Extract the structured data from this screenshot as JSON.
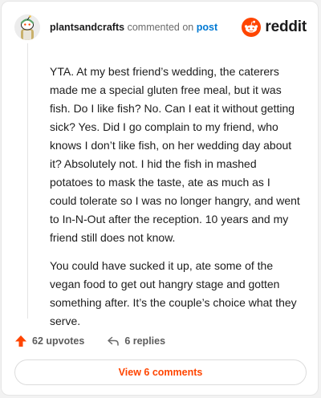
{
  "header": {
    "username": "plantsandcrafts",
    "action_text": "commented on",
    "post_link": "post",
    "brand": "reddit"
  },
  "comment": {
    "paragraphs": [
      "YTA. At my best friend’s wedding, the caterers made me a special gluten free meal, but it was fish. Do I like fish? No. Can I eat it without getting sick? Yes. Did I go complain to my friend, who knows I don’t like fish, on her wedding day about it? Absolutely not. I hid the fish in mashed potatoes to mask the taste, ate as much as I could tolerate so I was no longer hangry, and went to In-N-Out after the reception. 10 years and my friend still does not know.",
      "You could have sucked it up, ate some of the vegan food to get out hangry stage and gotten something after. It’s the couple’s choice what they serve."
    ]
  },
  "actions": {
    "upvotes": "62 upvotes",
    "replies": "6 replies"
  },
  "view_button": "View 6 comments",
  "colors": {
    "brand_orange": "#ff4500",
    "link_blue": "#0079d3"
  },
  "icons": [
    "avatar-snoo",
    "reddit-logo-icon",
    "upvote-arrow-icon",
    "reply-icon"
  ]
}
